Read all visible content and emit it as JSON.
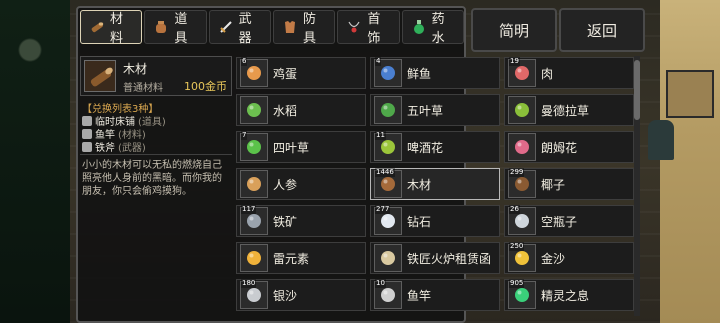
{
  "tabs": [
    {
      "label": "材料",
      "icon": "log-icon",
      "active": true
    },
    {
      "label": "道具",
      "icon": "potion-icon",
      "active": false
    },
    {
      "label": "武器",
      "icon": "sword-icon",
      "active": false
    },
    {
      "label": "防具",
      "icon": "armor-icon",
      "active": false
    },
    {
      "label": "首饰",
      "icon": "necklace-icon",
      "active": false
    },
    {
      "label": "药水",
      "icon": "flask-icon",
      "active": false
    }
  ],
  "buttons": {
    "simple": "简明",
    "back": "返回"
  },
  "detail": {
    "name": "木材",
    "category": "普通材料",
    "price": "100金币",
    "exchange_title": "【兑换列表3种】",
    "exchange": [
      {
        "name": "临时床铺",
        "tag": "(道具)"
      },
      {
        "name": "鱼竿",
        "tag": "(材料)"
      },
      {
        "name": "铁斧",
        "tag": "(武器)"
      }
    ],
    "description": "小小的木材可以无私的燃烧自己照亮他人身前的黑暗。而你我的朋友，你只会偷鸡摸狗。"
  },
  "items": [
    {
      "count": "6",
      "name": "鸡蛋",
      "icon": "egg-icon",
      "color": "#e89a4c"
    },
    {
      "count": "4",
      "name": "鲜鱼",
      "icon": "fish-icon",
      "color": "#4a7fd0"
    },
    {
      "count": "19",
      "name": "肉",
      "icon": "meat-icon",
      "color": "#e06868"
    },
    {
      "count": "",
      "name": "水稻",
      "icon": "rice-icon",
      "color": "#6cbf4f"
    },
    {
      "count": "",
      "name": "五叶草",
      "icon": "five-leaf-clover-icon",
      "color": "#4fa84a"
    },
    {
      "count": "",
      "name": "曼德拉草",
      "icon": "mandrake-icon",
      "color": "#8abf3a"
    },
    {
      "count": "7",
      "name": "四叶草",
      "icon": "four-leaf-clover-icon",
      "color": "#5bc24a"
    },
    {
      "count": "11",
      "name": "啤酒花",
      "icon": "hops-icon",
      "color": "#9bc53a"
    },
    {
      "count": "",
      "name": "朗姆花",
      "icon": "rum-flower-icon",
      "color": "#e06a8a"
    },
    {
      "count": "",
      "name": "人参",
      "icon": "ginseng-icon",
      "color": "#d9a05a"
    },
    {
      "count": "1446",
      "name": "木材",
      "icon": "wood-icon",
      "color": "#a56a3a",
      "selected": true
    },
    {
      "count": "299",
      "name": "椰子",
      "icon": "coconut-icon",
      "color": "#8a5a32"
    },
    {
      "count": "117",
      "name": "铁矿",
      "icon": "iron-ore-icon",
      "color": "#9aa3ad"
    },
    {
      "count": "277",
      "name": "钻石",
      "icon": "diamond-icon",
      "color": "#e2e8f0"
    },
    {
      "count": "26",
      "name": "空瓶子",
      "icon": "empty-bottle-icon",
      "color": "#cfd6dc"
    },
    {
      "count": "",
      "name": "雷元素",
      "icon": "thunder-element-icon",
      "color": "#f0b23a"
    },
    {
      "count": "",
      "name": "铁匠火炉租赁函",
      "icon": "scroll-icon",
      "color": "#d9c9a0"
    },
    {
      "count": "250",
      "name": "金沙",
      "icon": "gold-sand-icon",
      "color": "#f0c23a"
    },
    {
      "count": "180",
      "name": "银沙",
      "icon": "silver-sand-icon",
      "color": "#c9ccd0"
    },
    {
      "count": "10",
      "name": "鱼竿",
      "icon": "fishing-rod-icon",
      "color": "#d0d0d0"
    },
    {
      "count": "905",
      "name": "精灵之息",
      "icon": "spirit-breath-icon",
      "color": "#3ad07a"
    }
  ]
}
